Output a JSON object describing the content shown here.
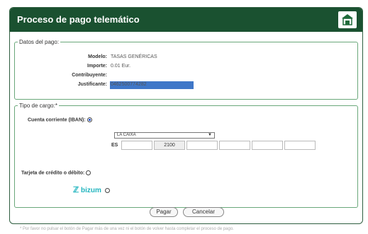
{
  "header": {
    "title": "Proceso de pago telemático"
  },
  "datos_pago": {
    "legend": "Datos del pago:",
    "modelo_label": "Modelo:",
    "modelo_value": "TASAS GENÉRICAS",
    "importe_label": "Importe:",
    "importe_value": "0.01 Eur.",
    "contribuyente_label": "Contribuyente:",
    "justificante_label": "Justificante:",
    "justificante_value": "0462500774282"
  },
  "tipo_cargo": {
    "legend": "Tipo de cargo:*",
    "cuenta_label": "Cuenta corriente (IBAN):",
    "bank_select": "LA CAIXA",
    "iban_prefix": "ES",
    "iban_fields": [
      "",
      "2100",
      "",
      "",
      "",
      ""
    ],
    "tarjeta_label": "Tarjeta de crédito o débito:",
    "bizum_label": "bizum"
  },
  "buttons": {
    "pagar": "Pagar",
    "cancelar": "Cancelar"
  },
  "footnote": "* Por favor no pulsar el botón de Pagar más de una vez ni el botón de volver hasta completar el proceso de pago.",
  "colors": {
    "header": "#1a5130",
    "border": "#6aa87a",
    "bizum": "#22b5bf",
    "radio_selected": "#1f4fd6"
  }
}
